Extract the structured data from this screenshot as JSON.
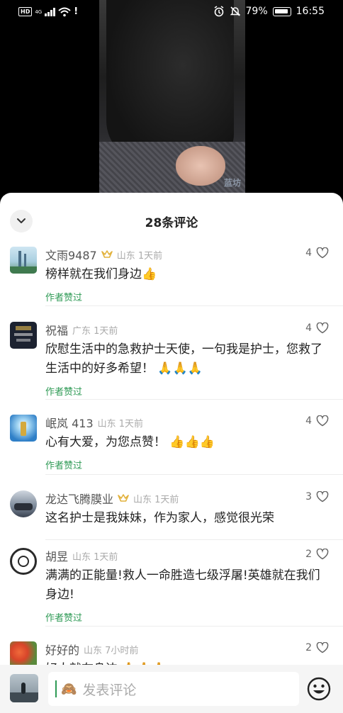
{
  "status_bar": {
    "left_badge": "HD",
    "network": "4G",
    "battery": "79%",
    "time": "16:55"
  },
  "video": {
    "watermark": "蓝坊"
  },
  "sheet": {
    "title": "28条评论"
  },
  "comments": [
    {
      "name": "文雨9487",
      "location": "山东 1天前",
      "likes": "4",
      "text": "榜样就在我们身边👍",
      "author_liked": "作者赞过"
    },
    {
      "name": "祝福",
      "location": "广东 1天前",
      "likes": "4",
      "text": "欣慰生活中的急救护士天使，一句我是护士，您救了生活中的好多希望！ 🙏🙏🙏",
      "author_liked": "作者赞过"
    },
    {
      "name": "岷岚 413",
      "location": "山东 1天前",
      "likes": "4",
      "text": "心有大爱，为您点赞！ 👍👍👍",
      "author_liked": "作者赞过"
    },
    {
      "name": "龙达飞腾膜业",
      "location": "山东 1天前",
      "likes": "3",
      "text": "这名护士是我妹妹，作为家人，感觉很光荣",
      "author_liked": ""
    },
    {
      "name": "胡昱",
      "location": "山东 1天前",
      "likes": "2",
      "text": "满满的正能量!救人一命胜造七级浮屠!英雄就在我们身边!",
      "author_liked": "作者赞过"
    },
    {
      "name": "好好的",
      "location": "山东 7小时前",
      "likes": "2",
      "text": "好人就在身边 🙏🙏🙏",
      "author_liked": ""
    }
  ],
  "input": {
    "placeholder": "发表评论"
  },
  "colors": {
    "accent_green": "#2e9a55",
    "crown_gold": "#e2b23d"
  }
}
